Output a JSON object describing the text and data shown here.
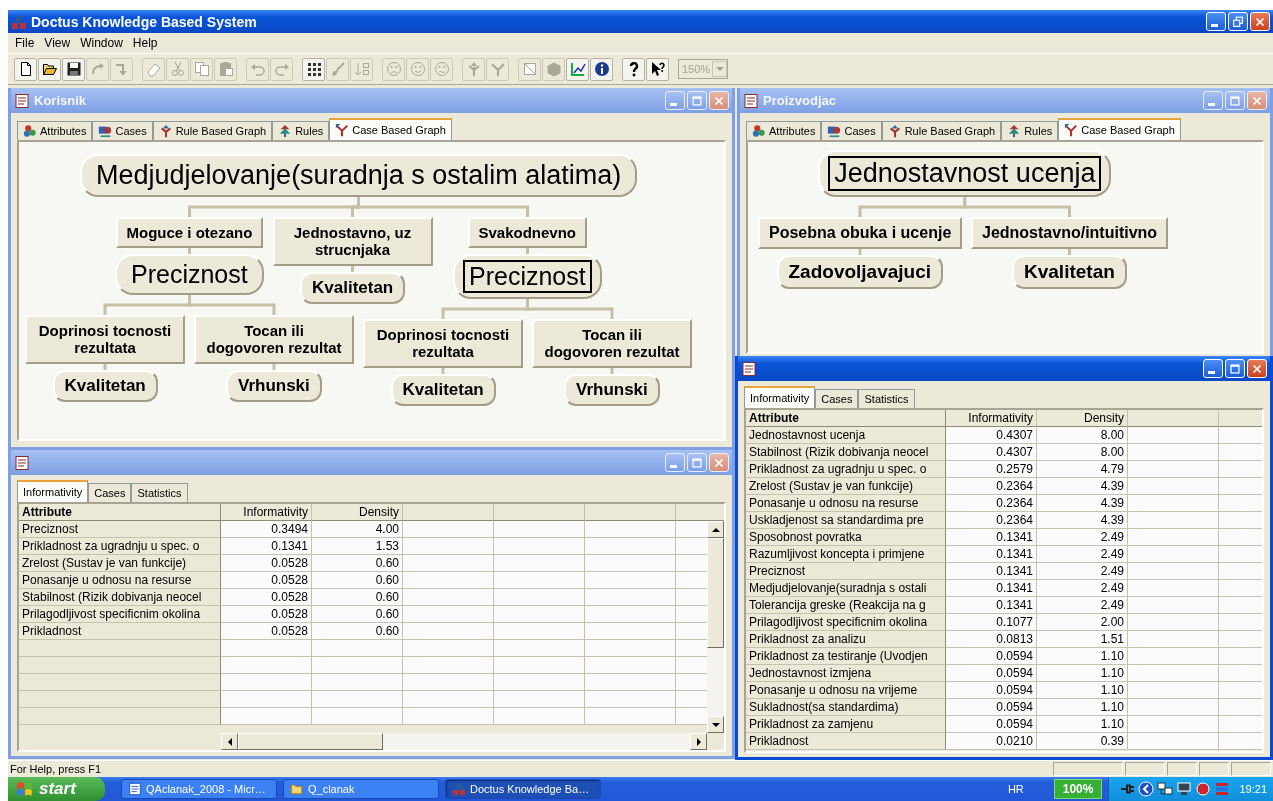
{
  "window": {
    "title": "Doctus Knowledge Based System"
  },
  "menu": [
    "File",
    "View",
    "Window",
    "Help"
  ],
  "toolbar": [
    [
      {
        "kind": "new",
        "disabled": false
      },
      {
        "kind": "open",
        "disabled": false
      },
      {
        "kind": "save",
        "disabled": false
      },
      {
        "kind": "import",
        "disabled": true
      },
      {
        "kind": "export",
        "disabled": true
      }
    ],
    [
      {
        "kind": "eraser",
        "disabled": true
      },
      {
        "kind": "cut",
        "disabled": true
      },
      {
        "kind": "copy",
        "disabled": true
      },
      {
        "kind": "paste",
        "disabled": true
      }
    ],
    [
      {
        "kind": "undo",
        "disabled": true
      },
      {
        "kind": "redo",
        "disabled": true
      }
    ],
    [
      {
        "kind": "grid",
        "disabled": false
      },
      {
        "kind": "brush",
        "disabled": true
      },
      {
        "kind": "sort",
        "disabled": true
      }
    ],
    [
      {
        "kind": "sad",
        "disabled": true
      },
      {
        "kind": "smile",
        "disabled": true
      },
      {
        "kind": "neutral",
        "disabled": true
      }
    ],
    [
      {
        "kind": "branch",
        "disabled": true
      },
      {
        "kind": "merge",
        "disabled": true
      }
    ],
    [
      {
        "kind": "crossed",
        "disabled": true
      },
      {
        "kind": "cube",
        "disabled": true
      },
      {
        "kind": "chart",
        "disabled": false
      },
      {
        "kind": "info",
        "disabled": false
      }
    ],
    [
      {
        "kind": "help",
        "disabled": false
      },
      {
        "kind": "help-pointer",
        "disabled": false
      }
    ]
  ],
  "zoom_box": {
    "value": "150%",
    "disabled": true
  },
  "windows": [
    {
      "kind": "graph",
      "title": "Korisnik",
      "active": false,
      "tabs": [
        {
          "label": "Attributes",
          "kind": "attributes",
          "selected": false
        },
        {
          "label": "Cases",
          "kind": "cases",
          "selected": false
        },
        {
          "label": "Rule Based Graph",
          "kind": "rule-graph",
          "selected": false
        },
        {
          "label": "Rules",
          "kind": "rules",
          "selected": false
        },
        {
          "label": "Case Based Graph",
          "kind": "case-graph",
          "selected": true
        }
      ],
      "graph": {
        "kind": "attribute",
        "label": "Medjudjelovanje(suradnja s ostalim alatima)",
        "selected": false,
        "children": [
          {
            "kind": "value",
            "label": "Moguce i otezano",
            "children": [
              {
                "kind": "attribute",
                "label": "Preciznost",
                "selected": false,
                "children": [
                  {
                    "kind": "value",
                    "label": "Doprinosi tocnosti rezultata",
                    "children": [
                      {
                        "kind": "result",
                        "label": "Kvalitetan"
                      }
                    ]
                  },
                  {
                    "kind": "value",
                    "label": "Tocan ili dogovoren rezultat",
                    "children": [
                      {
                        "kind": "result",
                        "label": "Vrhunski"
                      }
                    ]
                  }
                ]
              }
            ]
          },
          {
            "kind": "value",
            "label": "Jednostavno, uz strucnjaka",
            "children": [
              {
                "kind": "result",
                "label": "Kvalitetan"
              }
            ]
          },
          {
            "kind": "value",
            "label": "Svakodnevno",
            "children": [
              {
                "kind": "attribute",
                "label": "Preciznost",
                "selected": true,
                "children": [
                  {
                    "kind": "value",
                    "label": "Doprinosi tocnosti rezultata",
                    "children": [
                      {
                        "kind": "result",
                        "label": "Kvalitetan"
                      }
                    ]
                  },
                  {
                    "kind": "value",
                    "label": "Tocan ili dogovoren rezultat",
                    "children": [
                      {
                        "kind": "result",
                        "label": "Vrhunski"
                      }
                    ]
                  }
                ]
              }
            ]
          }
        ]
      }
    },
    {
      "kind": "graph",
      "title": "Proizvodjac",
      "active": false,
      "tabs": [
        {
          "label": "Attributes",
          "kind": "attributes",
          "selected": false
        },
        {
          "label": "Cases",
          "kind": "cases",
          "selected": false
        },
        {
          "label": "Rule Based Graph",
          "kind": "rule-graph",
          "selected": false
        },
        {
          "label": "Rules",
          "kind": "rules",
          "selected": false
        },
        {
          "label": "Case Based Graph",
          "kind": "case-graph",
          "selected": true
        }
      ],
      "graph": {
        "kind": "attribute",
        "label": "Jednostavnost ucenja",
        "selected": true,
        "children": [
          {
            "kind": "value",
            "label": "Posebna obuka i ucenje",
            "children": [
              {
                "kind": "result",
                "label": "Zadovoljavajuci"
              }
            ]
          },
          {
            "kind": "value",
            "label": "Jednostavno/intuitivno",
            "children": [
              {
                "kind": "result",
                "label": "Kvalitetan"
              }
            ]
          }
        ]
      }
    },
    {
      "kind": "table",
      "active": false,
      "tabs": [
        {
          "label": "Informativity",
          "selected": true
        },
        {
          "label": "Cases",
          "selected": false
        },
        {
          "label": "Statistics",
          "selected": false
        }
      ],
      "table": {
        "columns": [
          "Attribute",
          "Informativity",
          "Density"
        ],
        "rows": [
          [
            "Preciznost",
            "0.3494",
            "4.00"
          ],
          [
            "Prikladnost za ugradnju u spec. o",
            "0.1341",
            "1.53"
          ],
          [
            "Zrelost (Sustav je van funkcije)",
            "0.0528",
            "0.60"
          ],
          [
            "Ponasanje u odnosu na resurse",
            "0.0528",
            "0.60"
          ],
          [
            "Stabilnost (Rizik dobivanja neocel",
            "0.0528",
            "0.60"
          ],
          [
            "Prilagodljivost specificnim okolina",
            "0.0528",
            "0.60"
          ],
          [
            "Prikladnost",
            "0.0528",
            "0.60"
          ]
        ]
      }
    },
    {
      "kind": "table",
      "active": true,
      "tabs": [
        {
          "label": "Informativity",
          "selected": true
        },
        {
          "label": "Cases",
          "selected": false
        },
        {
          "label": "Statistics",
          "selected": false
        }
      ],
      "table": {
        "columns": [
          "Attribute",
          "Informativity",
          "Density"
        ],
        "rows": [
          [
            "Jednostavnost ucenja",
            "0.4307",
            "8.00"
          ],
          [
            "Stabilnost (Rizik dobivanja neocel",
            "0.4307",
            "8.00"
          ],
          [
            "Prikladnost za ugradnju u spec. o",
            "0.2579",
            "4.79"
          ],
          [
            "Zrelost (Sustav je van funkcije)",
            "0.2364",
            "4.39"
          ],
          [
            "Ponasanje u odnosu na resurse",
            "0.2364",
            "4.39"
          ],
          [
            "Uskladjenost sa standardima pre",
            "0.2364",
            "4.39"
          ],
          [
            "Sposobnost povratka",
            "0.1341",
            "2.49"
          ],
          [
            "Razumljivost koncepta i primjene",
            "0.1341",
            "2.49"
          ],
          [
            "Preciznost",
            "0.1341",
            "2.49"
          ],
          [
            "Medjudjelovanje(suradnja s ostali",
            "0.1341",
            "2.49"
          ],
          [
            "Tolerancija greske (Reakcija na g",
            "0.1341",
            "2.49"
          ],
          [
            "Prilagodljivost specificnim okolina",
            "0.1077",
            "2.00"
          ],
          [
            "Prikladnost za analizu",
            "0.0813",
            "1.51"
          ],
          [
            "Prikladnost za testiranje (Uvodjen",
            "0.0594",
            "1.10"
          ],
          [
            "Jednostavnost izmjena",
            "0.0594",
            "1.10"
          ],
          [
            "Ponasanje u odnosu na vrijeme",
            "0.0594",
            "1.10"
          ],
          [
            "Sukladnost(sa standardima)",
            "0.0594",
            "1.10"
          ],
          [
            "Prikladnost za zamjenu",
            "0.0594",
            "1.10"
          ],
          [
            "Prikladnost",
            "0.0210",
            "0.39"
          ]
        ]
      }
    }
  ],
  "status_bar": {
    "text": "For Help, press F1"
  },
  "taskbar": {
    "start": "start",
    "tasks": [
      {
        "label": "QAclanak_2008 - Micr…",
        "kind": "document",
        "selected": false
      },
      {
        "label": "Q_clanak",
        "kind": "folder",
        "selected": false
      },
      {
        "label": "Doctus Knowledge Ba…",
        "kind": "app",
        "selected": true
      }
    ],
    "language": "HR",
    "percent": "100%",
    "clock": "19:21"
  }
}
